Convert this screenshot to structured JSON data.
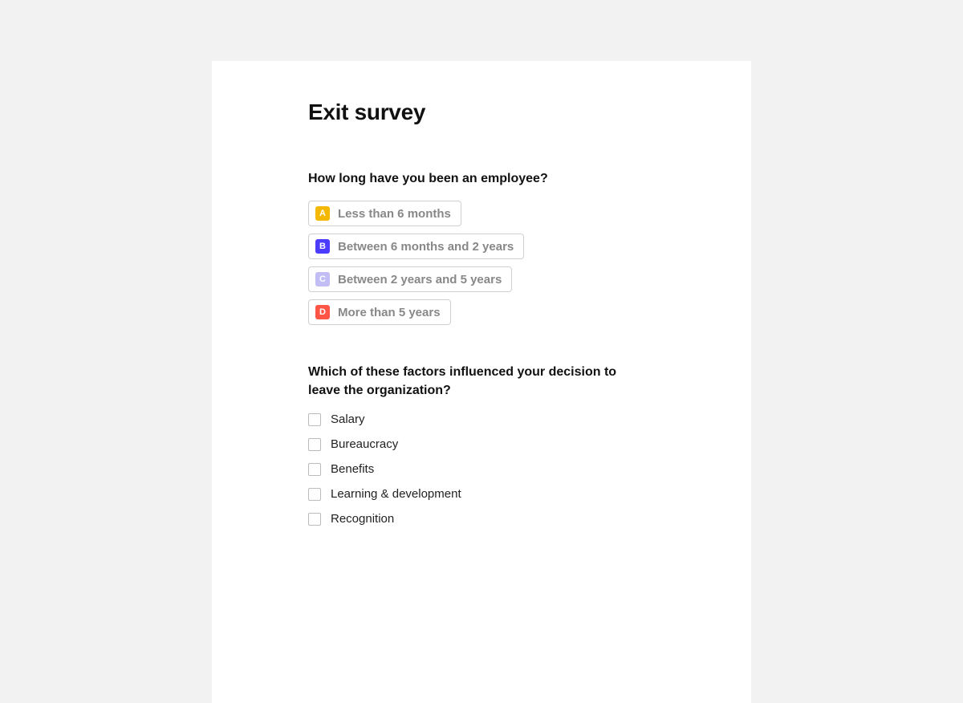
{
  "title": "Exit survey",
  "q1": {
    "label": "How long have you been an employee?",
    "options": [
      {
        "key": "A",
        "text": "Less than 6 months",
        "keybg": "#f5b800"
      },
      {
        "key": "B",
        "text": "Between 6 months and 2 years",
        "keybg": "#4b3cff"
      },
      {
        "key": "C",
        "text": "Between 2 years and 5 years",
        "keybg": "#c2bdf5"
      },
      {
        "key": "D",
        "text": "More than 5 years",
        "keybg": "#ff5547"
      }
    ]
  },
  "q2": {
    "label": "Which of these factors influenced your decision to leave the organization?",
    "options": [
      "Salary",
      "Bureaucracy",
      "Benefits",
      "Learning & development",
      "Recognition"
    ]
  }
}
